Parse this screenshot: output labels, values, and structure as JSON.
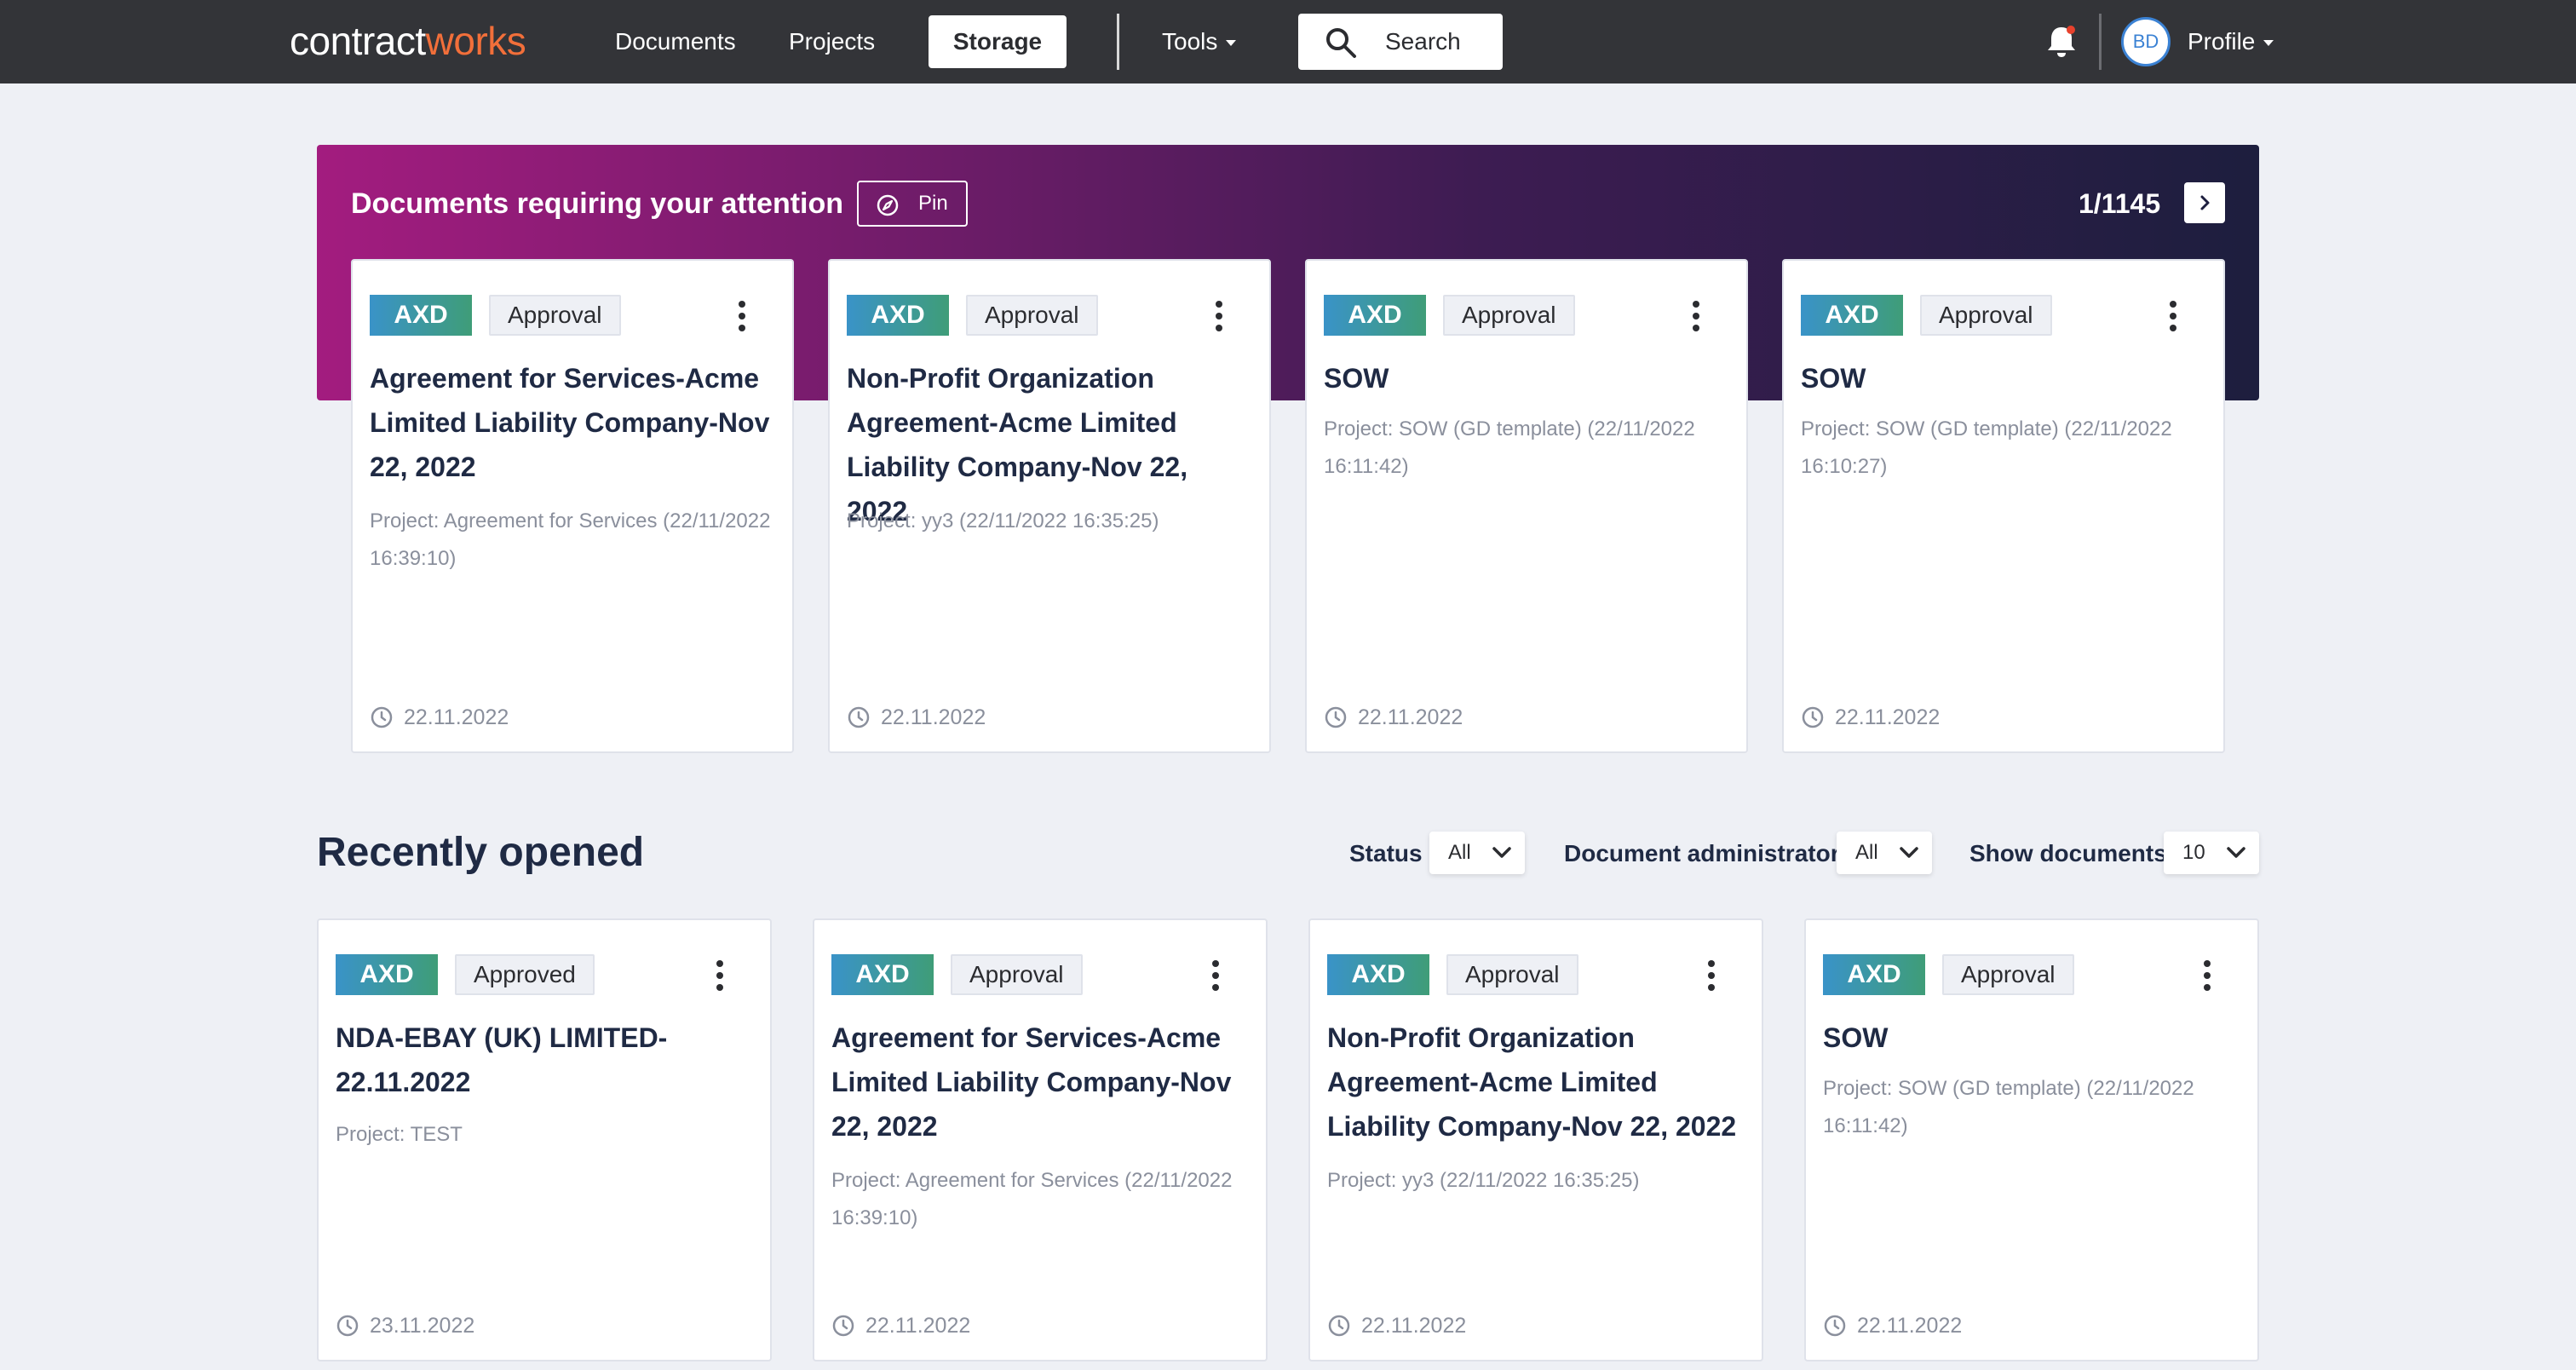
{
  "nav": {
    "logo_part1": "contract",
    "logo_part2": "works",
    "documents": "Documents",
    "projects": "Projects",
    "storage": "Storage",
    "tools": "Tools",
    "search": "Search",
    "avatar_initials": "BD",
    "profile": "Profile"
  },
  "attention": {
    "title": "Documents requiring your attention",
    "pin_label": "Pin",
    "pager": "1/1145",
    "cards": [
      {
        "tag": "AXD",
        "status": "Approval",
        "title": "Agreement for Services-Acme Limited Liability Company-Nov 22, 2022",
        "project": "Project: Agreement for Services (22/11/2022 16:39:10)",
        "date": "22.11.2022"
      },
      {
        "tag": "AXD",
        "status": "Approval",
        "title": "Non-Profit Organization Agreement-Acme Limited Liability Company-Nov 22, 2022",
        "project": "Project: yy3 (22/11/2022 16:35:25)",
        "date": "22.11.2022"
      },
      {
        "tag": "AXD",
        "status": "Approval",
        "title": "SOW",
        "project": "Project: SOW (GD template) (22/11/2022 16:11:42)",
        "date": "22.11.2022"
      },
      {
        "tag": "AXD",
        "status": "Approval",
        "title": "SOW",
        "project": "Project: SOW (GD template) (22/11/2022 16:10:27)",
        "date": "22.11.2022"
      }
    ]
  },
  "recent": {
    "title": "Recently opened",
    "filters": {
      "status_label": "Status",
      "status_value": "All",
      "admin_label": "Document administrator",
      "admin_value": "All",
      "show_label": "Show documents",
      "show_value": "10"
    },
    "cards": [
      {
        "tag": "AXD",
        "status": "Approved",
        "title": "NDA-EBAY (UK) LIMITED-22.11.2022",
        "project": "Project: TEST",
        "date": "23.11.2022"
      },
      {
        "tag": "AXD",
        "status": "Approval",
        "title": "Agreement for Services-Acme Limited Liability Company-Nov 22, 2022",
        "project": "Project: Agreement for Services (22/11/2022 16:39:10)",
        "date": "22.11.2022"
      },
      {
        "tag": "AXD",
        "status": "Approval",
        "title": "Non-Profit Organization Agreement-Acme Limited Liability Company-Nov 22, 2022",
        "project": "Project: yy3 (22/11/2022 16:35:25)",
        "date": "22.11.2022"
      },
      {
        "tag": "AXD",
        "status": "Approval",
        "title": "SOW",
        "project": "Project: SOW (GD template) (22/11/2022 16:11:42)",
        "date": "22.11.2022"
      }
    ]
  },
  "colors": {
    "navbar_bg": "#333438",
    "logo_accent": "#f26f3a",
    "banner_start": "#a31c7f",
    "banner_end": "#1d1e3e",
    "page_bg": "#eef0f5",
    "notification_dot": "#e8412c"
  },
  "icons": {
    "search": "search-icon",
    "bell": "bell-icon",
    "pin": "compass-icon",
    "next": "chevron-right-icon",
    "kebab": "kebab-icon",
    "clock": "clock-icon",
    "dropdown": "chevron-down-icon"
  }
}
